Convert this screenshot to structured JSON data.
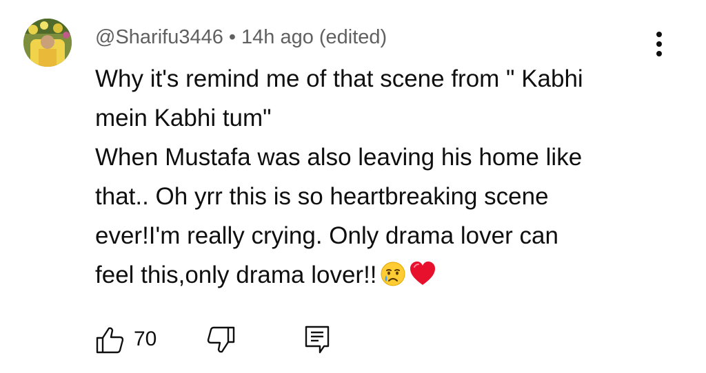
{
  "comment": {
    "author": "@Sharifu3446",
    "separator": "•",
    "timestamp": "14h ago (edited)",
    "lines": [
      "Why it's remind me of that scene from \" Kabhi",
      "mein Kabhi tum\"",
      "When Mustafa was also leaving his home like",
      "that.. Oh yrr this is so heartbreaking scene",
      "ever!I'm really crying.  Only drama lover can",
      "feel this,only drama lover!!"
    ],
    "emojis": [
      "crying-face",
      "red-heart"
    ]
  },
  "actions": {
    "like_icon": "thumbs-up-icon",
    "like_count": "70",
    "dislike_icon": "thumbs-down-icon",
    "reply_icon": "comment-reply-icon",
    "more_icon": "more-vertical-icon"
  },
  "colors": {
    "text_primary": "#0f0f0f",
    "text_secondary": "#606060",
    "heart": "#e8112d",
    "emoji_face": "#ffcc33"
  }
}
